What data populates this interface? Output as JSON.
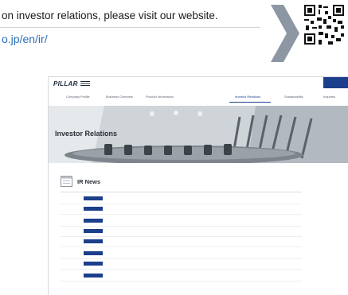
{
  "promo": {
    "caption": "on investor relations, please visit our website.",
    "url": "o.jp/en/ir/"
  },
  "site": {
    "logo": "PILLAR",
    "utility_link": "",
    "language_switch": "",
    "nav": [
      {
        "label": "Company Profile",
        "active": false
      },
      {
        "label": "Business Overview",
        "active": false
      },
      {
        "label": "Product Information",
        "active": false
      },
      {
        "label": "Investor Relations",
        "active": true
      },
      {
        "label": "Sustainability",
        "active": false
      },
      {
        "label": "Inquiries",
        "active": false
      }
    ],
    "hero_title": "Investor Relations",
    "ir_news": {
      "title": "IR News",
      "items": [
        {
          "date": "",
          "badge": "",
          "title": "",
          "lines": 1
        },
        {
          "date": "",
          "badge": "",
          "title": "",
          "lines": 2
        },
        {
          "date": "",
          "badge": "",
          "title": "",
          "lines": 1
        },
        {
          "date": "",
          "badge": "",
          "title": "",
          "lines": 1
        },
        {
          "date": "",
          "badge": "",
          "title": "",
          "lines": 2
        },
        {
          "date": "",
          "badge": "",
          "title": "",
          "lines": 1
        },
        {
          "date": "",
          "badge": "",
          "title": "",
          "lines": 2
        },
        {
          "date": "",
          "badge": "",
          "title": "",
          "lines": 1
        }
      ]
    }
  },
  "colors": {
    "link_blue": "#2a6fb8",
    "brand_navy": "#1b3f8b",
    "chevron_gray": "#8c97a3"
  }
}
